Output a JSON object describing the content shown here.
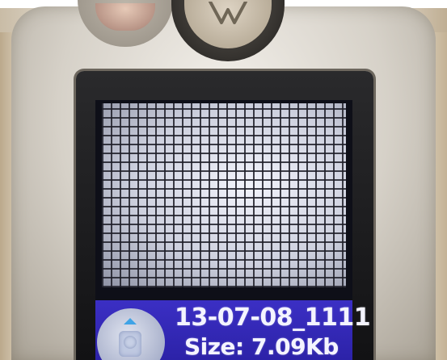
{
  "photo": {
    "subject": "phone camera viewfinder photo",
    "grid_visible": true
  },
  "info_bar": {
    "file_name": "13-07-08_1111",
    "file_size": "Size: 7.09Kb",
    "accent_color": "#2c22a8"
  },
  "icons": {
    "nav": "navigation-pad-icon",
    "logo": "motorola-logo-icon"
  }
}
